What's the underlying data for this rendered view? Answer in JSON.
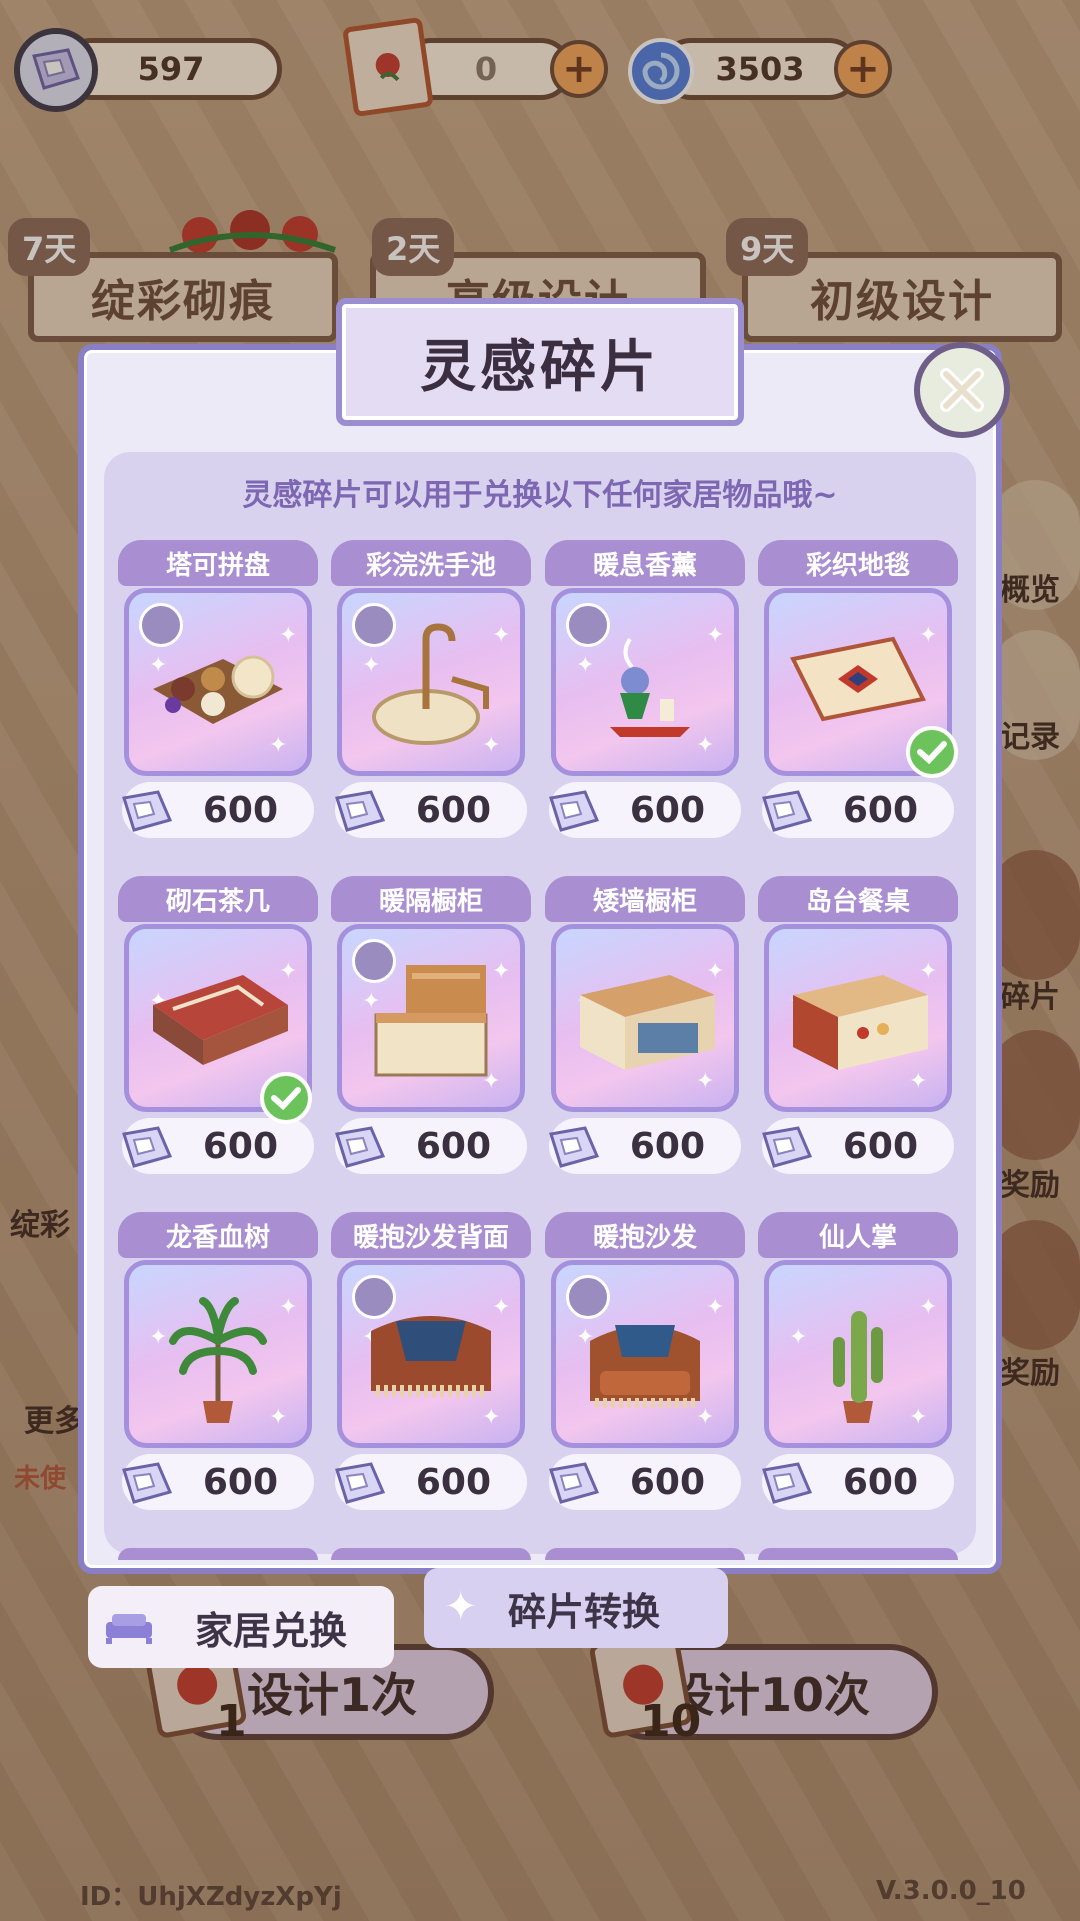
{
  "currency": {
    "fragments": "597",
    "tickets": "0",
    "swirl": "3503"
  },
  "top_tabs": [
    {
      "label": "绽彩砌痕",
      "days": "7天"
    },
    {
      "label": "高级设计",
      "days": "2天"
    },
    {
      "label": "初级设计",
      "days": "9天"
    }
  ],
  "side_labels": {
    "overview": "概览",
    "record": "记录",
    "fragment": "碎片",
    "reward1": "奖励",
    "reward2": "奖励",
    "left_a": "绽彩",
    "left_b": "更多",
    "left_c": "未使"
  },
  "modal": {
    "title": "灵感碎片",
    "subtitle": "灵感碎片可以用于兑换以下任何家居物品哦~",
    "items": [
      {
        "name": "塔可拼盘",
        "price": "600",
        "owned": false
      },
      {
        "name": "彩浣洗手池",
        "price": "600",
        "owned": false
      },
      {
        "name": "暖息香薰",
        "price": "600",
        "owned": false
      },
      {
        "name": "彩织地毯",
        "price": "600",
        "owned": true
      },
      {
        "name": "砌石茶几",
        "price": "600",
        "owned": true
      },
      {
        "name": "暖隔橱柜",
        "price": "600",
        "owned": false
      },
      {
        "name": "矮墙橱柜",
        "price": "600",
        "owned": false
      },
      {
        "name": "岛台餐桌",
        "price": "600",
        "owned": false
      },
      {
        "name": "龙香血树",
        "price": "600",
        "owned": false
      },
      {
        "name": "暖抱沙发背面",
        "price": "600",
        "owned": false
      },
      {
        "name": "暖抱沙发",
        "price": "600",
        "owned": false
      },
      {
        "name": "仙人掌",
        "price": "600",
        "owned": false
      }
    ]
  },
  "bottom_tabs": {
    "home_exchange": "家居兑换",
    "fragment_convert": "碎片转换"
  },
  "design_buttons": {
    "once": "设计1次",
    "once_count": "1",
    "ten": "设计10次",
    "ten_count": "10"
  },
  "footer": {
    "id": "ID：UhjXZdyzXpYj",
    "version": "V.3.0.0_10"
  },
  "colors": {
    "accent_purple": "#a98fd2",
    "panel_bg": "#edeaf8",
    "owned_green": "#6cc35c"
  }
}
